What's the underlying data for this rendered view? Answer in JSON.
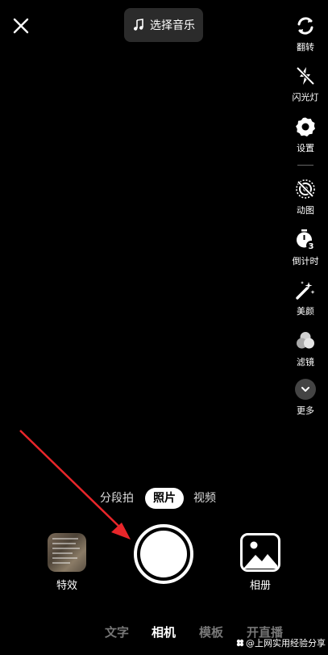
{
  "music": {
    "label": "选择音乐",
    "icon": "music-note-icon"
  },
  "side_tools": [
    {
      "name": "flip",
      "label": "翻转",
      "icon": "flip-camera-icon"
    },
    {
      "name": "flash",
      "label": "闪光灯",
      "icon": "flash-off-icon"
    },
    {
      "name": "settings",
      "label": "设置",
      "icon": "gear-icon"
    },
    {
      "name": "live-photo",
      "label": "动图",
      "icon": "live-photo-off-icon"
    },
    {
      "name": "timer",
      "label": "倒计时",
      "icon": "timer-3s-icon"
    },
    {
      "name": "beauty",
      "label": "美颜",
      "icon": "magic-wand-icon"
    },
    {
      "name": "filter",
      "label": "滤镜",
      "icon": "filter-circles-icon"
    },
    {
      "name": "more",
      "label": "更多",
      "icon": "chevron-down-icon"
    }
  ],
  "capture_modes": [
    {
      "label": "分段拍",
      "active": false
    },
    {
      "label": "照片",
      "active": true
    },
    {
      "label": "视频",
      "active": false
    }
  ],
  "effects": {
    "label": "特效"
  },
  "album": {
    "label": "相册"
  },
  "bottom_tabs": [
    {
      "label": "文字",
      "active": false
    },
    {
      "label": "相机",
      "active": true
    },
    {
      "label": "模板",
      "active": false
    },
    {
      "label": "开直播",
      "active": false
    }
  ],
  "watermark": {
    "text": "@上网实用经验分享"
  },
  "colors": {
    "background": "#000000",
    "arrow": "#e8262a",
    "active_mode_bg": "#ffffff"
  }
}
